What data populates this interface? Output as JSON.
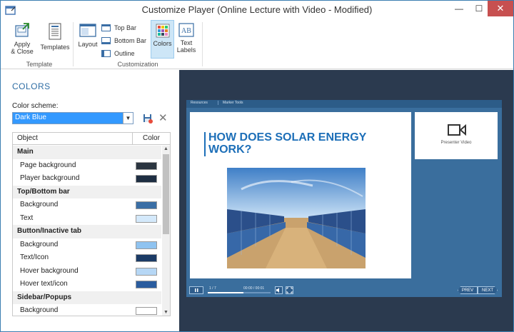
{
  "window": {
    "title": "Customize Player (Online Lecture with Video - Modified)"
  },
  "ribbon": {
    "apply_close": "Apply\n& Close",
    "templates": "Templates",
    "template_group": "Template",
    "layout": "Layout",
    "top_bar": "Top Bar",
    "bottom_bar": "Bottom Bar",
    "outline": "Outline",
    "colors": "Colors",
    "text_labels": "Text\nLabels",
    "customization_group": "Customization"
  },
  "panel": {
    "title": "COLORS",
    "scheme_label": "Color scheme:",
    "scheme_value": "Dark Blue",
    "col_object": "Object",
    "col_color": "Color",
    "rows": [
      {
        "type": "group",
        "label": "Main"
      },
      {
        "type": "item",
        "label": "Page background",
        "color": "#2b3540"
      },
      {
        "type": "item",
        "label": "Player background",
        "color": "#1e2e42"
      },
      {
        "type": "group",
        "label": "Top/Bottom bar"
      },
      {
        "type": "item",
        "label": "Background",
        "color": "#3a6ea5"
      },
      {
        "type": "item",
        "label": "Text",
        "color": "#d4e9fb"
      },
      {
        "type": "group",
        "label": "Button/Inactive tab"
      },
      {
        "type": "item",
        "label": "Background",
        "color": "#8fc3f0"
      },
      {
        "type": "item",
        "label": "Text/Icon",
        "color": "#1b3b66"
      },
      {
        "type": "item",
        "label": "Hover background",
        "color": "#b6d7f5"
      },
      {
        "type": "item",
        "label": "Hover text/icon",
        "color": "#2a5c9e"
      },
      {
        "type": "group",
        "label": "Sidebar/Popups"
      },
      {
        "type": "item",
        "label": "Background",
        "color": "#ffffff"
      }
    ]
  },
  "preview": {
    "tab_resources": "Resources",
    "tab_marker": "Marker Tools",
    "slide_title": "HOW DOES SOLAR ENERGY WORK?",
    "presenter_video": "Presenter Video",
    "slide_counter": "1 / 7",
    "time": "00:00 / 00:01",
    "progress_fraction": 0.57,
    "prev": "PREV",
    "next": "NEXT"
  }
}
